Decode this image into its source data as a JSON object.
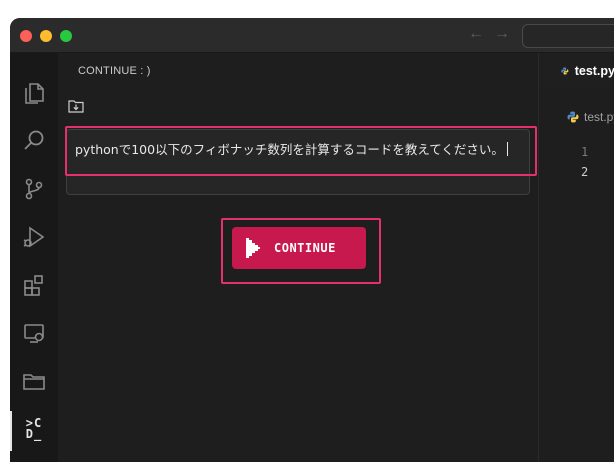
{
  "panel": {
    "title": "CONTINUE : )",
    "input_text": "pythonで100以下のフィボナッチ数列を計算するコードを教えてください。",
    "continue_label": "CONTINUE"
  },
  "activity_bar": {
    "items": [
      "explorer-icon",
      "search-icon",
      "source-control-icon",
      "run-debug-icon",
      "extensions-icon",
      "remote-explorer-icon",
      "folder-icon",
      "continue-icon"
    ],
    "continue_logo_top": ">C",
    "continue_logo_bottom": "D_"
  },
  "titlebar": {
    "back": "←",
    "forward": "→"
  },
  "editor": {
    "tab_label": "test.py",
    "breadcrumb": "test.py",
    "line_numbers": [
      "1",
      "2"
    ]
  },
  "colors": {
    "accent": "#c8194f",
    "highlight": "#e5306b",
    "background": "#1e1e1e"
  }
}
